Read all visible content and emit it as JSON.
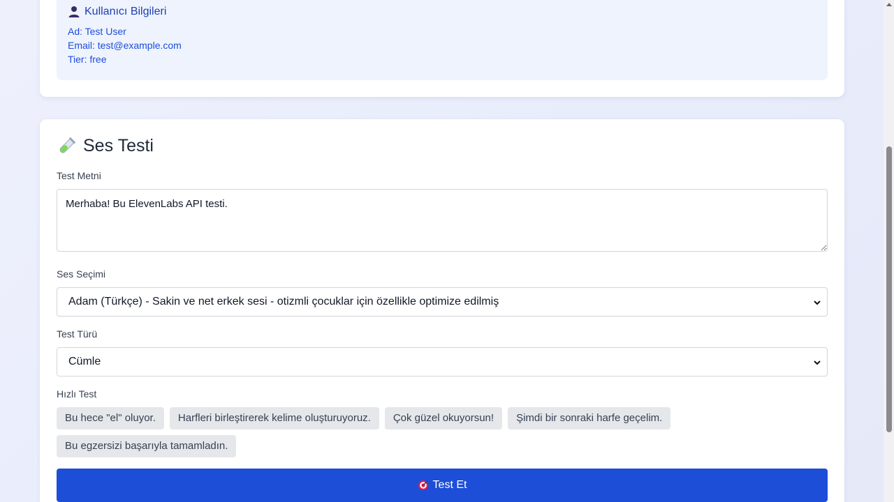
{
  "user_info": {
    "title": "Kullanıcı Bilgileri",
    "icon": "user-icon",
    "name_line": "Ad: Test User",
    "email_line": "Email: test@example.com",
    "tier_line": "Tier: free"
  },
  "voice_test": {
    "title": "Ses Testi",
    "icon": "test-tube-icon",
    "text_label": "Test Metni",
    "text_value": "Merhaba! Bu ElevenLabs API testi.",
    "voice_label": "Ses Seçimi",
    "voice_selected": "Adam (Türkçe) - Sakin ve net erkek sesi - otizmli çocuklar için özellikle optimize edilmiş",
    "type_label": "Test Türü",
    "type_selected": "Cümle",
    "quick_label": "Hızlı Test",
    "quick_items": [
      "Bu hece \"el\" oluyor.",
      "Harfleri birleştirerek kelime oluşturuyoruz.",
      "Çok güzel okuyorsun!",
      "Şimdi bir sonraki harfe geçelim.",
      "Bu egzersizi başarıyla tamamladın."
    ],
    "submit_label": "Test Et",
    "submit_icon": "target-icon"
  },
  "colors": {
    "accent": "#1d4ed8",
    "info_bg": "#eef3fe",
    "chip_bg": "#e5e7eb"
  }
}
